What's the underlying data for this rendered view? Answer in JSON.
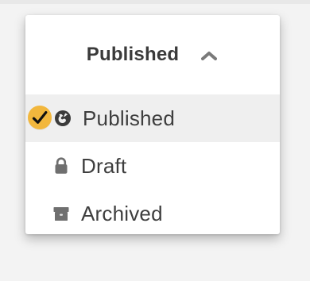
{
  "menu": {
    "header": {
      "label": "Published",
      "chevron_icon": "chevron-up-icon"
    },
    "options": [
      {
        "label": "Published",
        "icon": "globe-icon",
        "selected": true
      },
      {
        "label": "Draft",
        "icon": "lock-icon",
        "selected": false
      },
      {
        "label": "Archived",
        "icon": "archive-box-icon",
        "selected": false
      }
    ],
    "colors": {
      "accent_check": "#f2b73d",
      "text": "#3e3e3e",
      "icon": "#6f6f6f"
    }
  }
}
